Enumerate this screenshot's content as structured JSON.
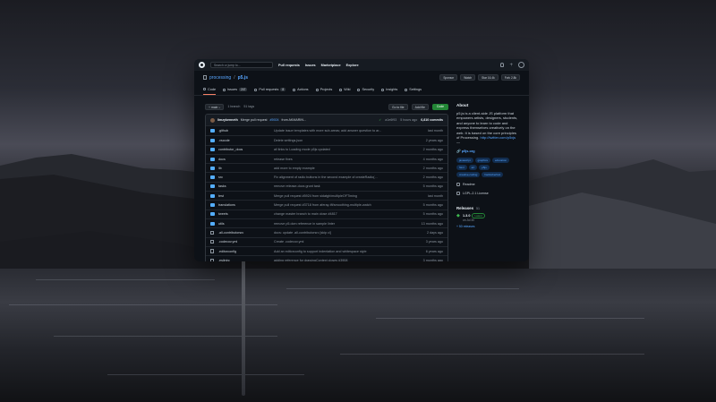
{
  "topbar": {
    "search_placeholder": "Search or jump to...",
    "nav": [
      "Pull requests",
      "Issues",
      "Marketplace",
      "Explore"
    ]
  },
  "repo": {
    "owner": "processing",
    "separator": "/",
    "name": "p5.js",
    "sponsor": "Sponsor",
    "watch": "Watch",
    "star": "Star",
    "star_count": "16.4k",
    "fork": "Fork",
    "fork_count": "2.8k"
  },
  "tabs": [
    {
      "label": "Code"
    },
    {
      "label": "Issues",
      "count": "247"
    },
    {
      "label": "Pull requests",
      "count": "8"
    },
    {
      "label": "Actions"
    },
    {
      "label": "Projects"
    },
    {
      "label": "Wiki"
    },
    {
      "label": "Security"
    },
    {
      "label": "Insights"
    },
    {
      "label": "Settings"
    }
  ],
  "branchbar": {
    "branch": "main",
    "branches": "1 branch",
    "tags": "51 tags",
    "goto": "Go to file",
    "addfile": "Add file",
    "code": "Code"
  },
  "commit": {
    "author": "limzykenneth",
    "message": "Merge pull request",
    "pr": "#5924",
    "message_rest": "from AKMARIN...",
    "check": "✓",
    "hash": "a1e6f93",
    "time": "5 hours ago",
    "count": "6,810 commits"
  },
  "files": [
    {
      "type": "dir",
      "name": ".github",
      "msg": "Update issue templates with more sub-areas; add answer question to ar...",
      "time": "last month"
    },
    {
      "type": "dir",
      "name": ".vscode",
      "msg": "Delete settings.json",
      "time": "2 years ago"
    },
    {
      "type": "dir",
      "name": "contributor_docs",
      "msg": "all links to Loading mode p5js updated",
      "time": "2 months ago"
    },
    {
      "type": "dir",
      "name": "docs",
      "msg": "release fixes",
      "time": "4 months ago"
    },
    {
      "type": "dir",
      "name": "lib",
      "msg": "add more to empty example",
      "time": "2 months ago"
    },
    {
      "type": "dir",
      "name": "src",
      "msg": "Fix alignment of radio buttons in the second example of createRadio(...",
      "time": "2 months ago"
    },
    {
      "type": "dir",
      "name": "tasks",
      "msg": "remove release-docs grunt task",
      "time": "5 months ago"
    },
    {
      "type": "dir",
      "name": "test",
      "msg": "Merge pull request #5924 from sidatgh/multipleOFTiming",
      "time": "last month"
    },
    {
      "type": "dir",
      "name": "translations",
      "msg": "Merge pull request #3718 from aferay-tft/smoothing-multiple-watch",
      "time": "5 months ago"
    },
    {
      "type": "dir",
      "name": "tweets",
      "msg": "change master branch to main close #4817",
      "time": "5 months ago"
    },
    {
      "type": "dir",
      "name": "utils",
      "msg": "remove p5.dom reference in sample linter",
      "time": "13 months ago"
    },
    {
      "type": "file",
      "name": ".all-contributorsrc",
      "msg": "docs: update .all-contributorsrc [skip ci]",
      "time": "2 days ago"
    },
    {
      "type": "file",
      "name": ".codecov.yml",
      "msg": "Create .codecov.yml",
      "time": "3 years ago"
    },
    {
      "type": "file",
      "name": ".editorconfig",
      "msg": "Add an editorconfig to support indentation and whitespace style",
      "time": "6 years ago"
    },
    {
      "type": "file",
      "name": ".eslintrc",
      "msg": "adding reference for drawingContext closes #3908",
      "time": "3 months ago"
    }
  ],
  "sidebar": {
    "about": "About",
    "description": "p5.js is a client-side JS platform that empowers artists, designers, students, and anyone to learn to code and express themselves creatively on the web. It is based on the core principles of Processing.",
    "desc_link": "http://twitter.com/p5xjs",
    "desc_link_suffix": "—",
    "website": "p5js.org",
    "topics": [
      "javascript",
      "graphics",
      "education",
      "html",
      "art",
      "p5js",
      "creative-coding",
      "hacktoberfest"
    ],
    "readme": "Readme",
    "license": "LGPL-2.1 License",
    "releases": "Releases",
    "releases_count": "51",
    "release_ver": "1.3.0",
    "release_badge": "Latest",
    "release_date": "on Jul 30",
    "release_more": "+ 50 releases"
  }
}
